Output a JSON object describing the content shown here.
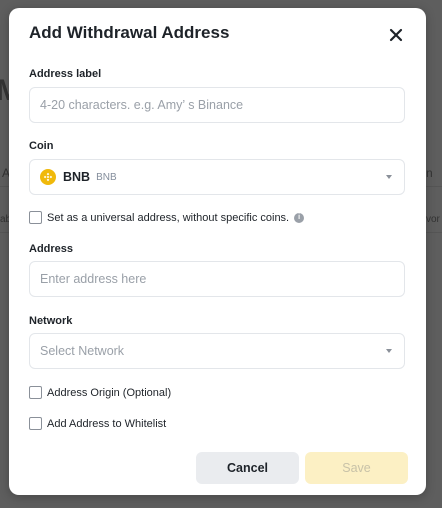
{
  "modal": {
    "title": "Add Withdrawal Address",
    "address_label": {
      "label": "Address label",
      "placeholder": "4-20 characters. e.g. Amy’ s Binance"
    },
    "coin": {
      "label": "Coin",
      "symbol": "BNB",
      "name": "BNB"
    },
    "universal": {
      "text": "Set as a universal address, without specific coins."
    },
    "address": {
      "label": "Address",
      "placeholder": "Enter address here"
    },
    "network": {
      "label": "Network",
      "placeholder": "Select Network"
    },
    "address_origin": {
      "text": "Address Origin (Optional)"
    },
    "whitelist": {
      "text": "Add Address to Whitelist"
    },
    "buttons": {
      "cancel": "Cancel",
      "save": "Save"
    }
  },
  "background": {
    "m": "M",
    "a": "A",
    "ab": "ab",
    "n": "n",
    "sv": "vor"
  },
  "colors": {
    "accent": "#f0b90b",
    "save_disabled": "#fcf0c4"
  }
}
